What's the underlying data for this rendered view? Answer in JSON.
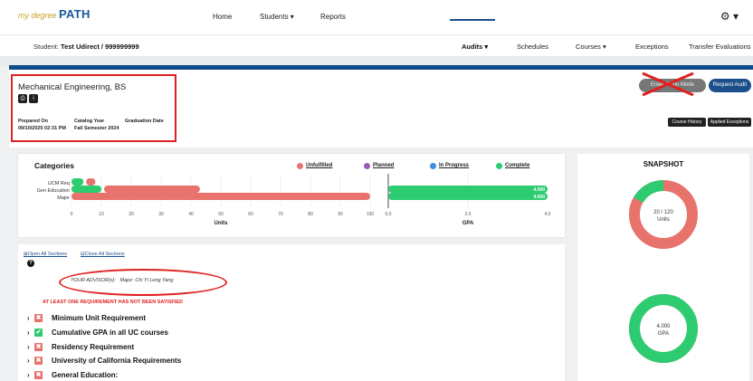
{
  "logo": {
    "prefix": "my degree",
    "name": "PATH"
  },
  "nav": {
    "home": "Home",
    "students": "Students ▾",
    "reports": "Reports",
    "gear": "⚙ ▾"
  },
  "subnav": {
    "student_label": "Student:",
    "student_value": "Test Udirect / 999999999",
    "tabs": [
      "Audits ▾",
      "Schedules",
      "Courses ▾",
      "Exceptions",
      "Transfer Evaluations"
    ]
  },
  "degree": {
    "title": "Mechanical Engineering, BS",
    "prepared_on_label": "Prepared On",
    "prepared_on_value": "09/10/2025 02:31 PM",
    "catalog_year_label": "Catalog Year",
    "catalog_year_value": "Fall Semester 2024",
    "grad_date_label": "Graduation Date"
  },
  "buttons": {
    "what_if": "Enter What-If Mode",
    "what_if_visible": "Enter P    tion Mode",
    "request_audit": "Request Audit",
    "course_history": "Course History",
    "applied_exceptions": "Applied Exceptions"
  },
  "colors": {
    "unfulfilled": "#e8736c",
    "planned": "#9b59b6",
    "in_progress": "#3a8fd9",
    "complete": "#2ecc71",
    "accent": "#0d4a8a",
    "alert": "#e02020"
  },
  "categories": {
    "title": "Categories",
    "legend": [
      "Unfulfilled",
      "Planned",
      "In Progress",
      "Complete"
    ]
  },
  "chart_data": {
    "type": "bar",
    "title": "Categories",
    "xlabel": "Units",
    "categories": [
      "UCM Req",
      "Gen Education",
      "Major"
    ],
    "series": [
      {
        "name": "Complete",
        "values": [
          4,
          10,
          0
        ]
      },
      {
        "name": "Unfulfilled",
        "values": [
          4,
          33,
          100
        ]
      }
    ],
    "xlim": [
      0,
      100
    ],
    "xticks": [
      "0",
      "10",
      "20",
      "30",
      "40",
      "50",
      "60",
      "70",
      "80",
      "90",
      "100"
    ],
    "gpa": {
      "xlabel": "GPA",
      "values": [
        4.0,
        4.0
      ],
      "value_labels": [
        "4.000",
        "4.000"
      ],
      "xlim": [
        0,
        4
      ],
      "xticks": [
        "0.0",
        "2.0",
        "4.0"
      ]
    }
  },
  "snapshot": {
    "title": "SNAPSHOT",
    "units_label": "20 / 120",
    "units_sub": "Units",
    "units_fraction": 0.1667,
    "gpa_label": "4.000",
    "gpa_sub": "GPA",
    "gpa_fraction": 1.0
  },
  "sections": {
    "open_all": "Open All Sections",
    "close_all": "Close All Sections",
    "advisor_label": "YOUR ADVISOR(s):",
    "advisor_value": "Major: Chi Yi Leng Yang",
    "warning": "AT LEAST ONE REQUIREMENT HAS NOT BEEN SATISFIED",
    "requirements": [
      {
        "label": "Minimum Unit Requirement",
        "status": "unfulfilled"
      },
      {
        "label": "Cumulative GPA in all UC courses",
        "status": "complete"
      },
      {
        "label": "Residency Requirement",
        "status": "unfulfilled"
      },
      {
        "label": "University of California Requirements",
        "status": "unfulfilled"
      },
      {
        "label": "General Education:",
        "status": "unfulfilled"
      }
    ]
  }
}
